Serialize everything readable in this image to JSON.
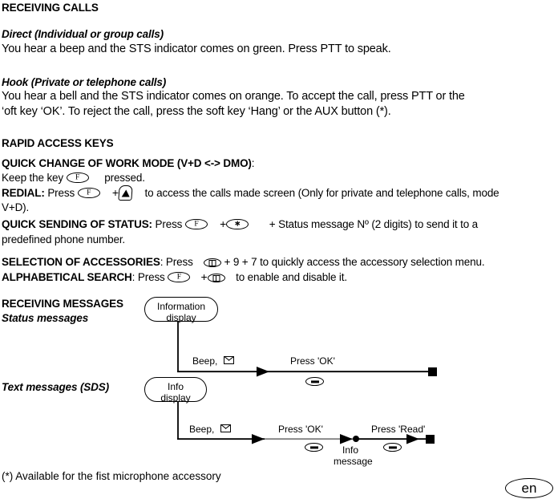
{
  "sections": {
    "receiving_calls": {
      "heading": "RECEIVING CALLS",
      "direct": {
        "subheading": "Direct (Individual or group calls)",
        "body": "You hear a beep and the STS indicator comes on green. Press PTT to speak."
      },
      "hook": {
        "subheading": "Hook (Private or telephone calls)",
        "body_line1": "You hear a bell and the STS indicator comes on orange. To accept the call, press PTT or the",
        "body_line2": "‘oft key ‘OK’. To reject the call, press the soft key ‘Hang’ or the AUX button (*)."
      }
    },
    "rapid_access_keys": {
      "heading": "RAPID ACCESS KEYS",
      "quick_change": {
        "label": "QUICK CHANGE OF WORK MODE (V+D <-> DMO)",
        "colon": ":",
        "line_pre": "Keep the key",
        "key": "F",
        "line_post": "pressed."
      },
      "redial": {
        "label": "REDIAL:",
        "pre": "Press",
        "key1": "F",
        "plus": "+",
        "key2_icon": "up-triangle-key-icon",
        "post": "to access the calls made screen (Only for private and telephone calls, mode",
        "line2": "V+D)."
      },
      "quick_status": {
        "label": "QUICK SENDING OF STATUS:",
        "pre": "Press",
        "key1": "F",
        "plus": "+",
        "key2": "∗",
        "post": "+ Status message Nº (2 digits) to send it to a",
        "line2": "predefined phone number."
      },
      "accessories": {
        "label": "SELECTION OF ACCESSORIES",
        "colon": ":",
        "pre": "Press",
        "key1_icon": "book-key-icon",
        "post": "+ 9 + 7 to quickly access the accessory selection menu."
      },
      "alphabetical": {
        "label": "ALPHABETICAL SEARCH",
        "colon": ":",
        "pre": "Press",
        "key1": "F",
        "plus": "+",
        "key2_icon": "book-key-icon",
        "post": "to enable and disable it."
      }
    },
    "receiving_messages": {
      "heading": "RECEIVING MESSAGES",
      "subheading": "Status messages",
      "sds_heading": "Text messages (SDS)"
    }
  },
  "diagram": {
    "status_flow": {
      "node_line1": "Information",
      "node_line2": "display",
      "label_beep": "Beep,",
      "icon_envelope": "envelope-icon",
      "label_press_ok": "Press 'OK'",
      "icon_softkey": "soft-key-icon",
      "terminator": "end-state"
    },
    "sds_flow": {
      "node_line1": "Info",
      "node_line2": "display",
      "label_beep": "Beep,",
      "icon_envelope": "envelope-icon",
      "label_press_ok": "Press 'OK'",
      "icon_softkey_ok": "soft-key-icon",
      "junction_line1": "Info",
      "junction_line2": "message",
      "label_press_read": "Press 'Read'",
      "icon_softkey_read": "soft-key-icon",
      "terminator": "end-state"
    }
  },
  "footer": {
    "footnote": "(*) Available for the fist microphone accessory",
    "language_badge": "en"
  },
  "colors": {
    "ink": "#000000",
    "paper": "#ffffff",
    "gray_line": "#808080"
  }
}
